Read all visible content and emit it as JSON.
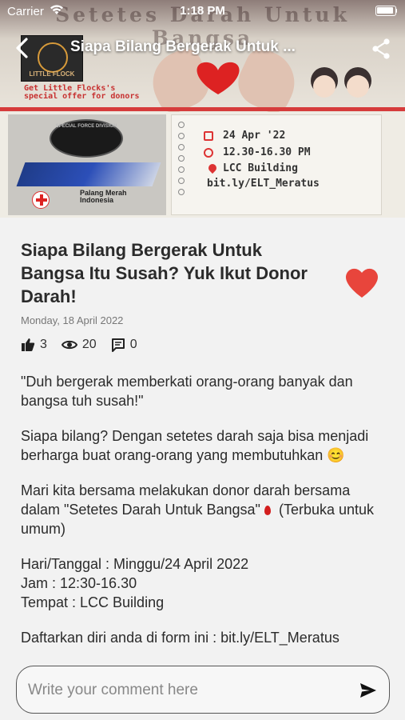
{
  "status_bar": {
    "carrier": "Carrier",
    "time": "1:18 PM"
  },
  "navbar": {
    "title": "Siapa Bilang Bergerak Untuk ..."
  },
  "hero": {
    "banner_text": "Setetes Darah Untuk Bangsa",
    "logo_label": "LITTLE FLOCK",
    "offer_text": "Get Little Flocks's special offer for donors",
    "badge_label": "SPECIAL FORCE DIVISION",
    "pmi_text": "Palang Merah Indonesia",
    "details": [
      "24 Apr '22",
      "12.30-16.30 PM",
      "LCC Building",
      "bit.ly/ELT_Meratus"
    ]
  },
  "post": {
    "title": "Siapa Bilang Bergerak Untuk Bangsa Itu Susah? Yuk Ikut Donor Darah!",
    "date": "Monday, 18 April 2022",
    "likes": "3",
    "views": "20",
    "comments": "0",
    "paragraphs": {
      "p1": "\"Duh bergerak memberkati orang-orang banyak dan bangsa tuh susah!\"",
      "p2": "Siapa bilang? Dengan setetes darah saja bisa menjadi berharga buat orang-orang yang membutuhkan 😊",
      "p3a": "Mari kita bersama melakukan donor darah bersama dalam \"Setetes Darah Untuk Bangsa\"",
      "p3b": "(Terbuka untuk umum)",
      "p4_line1": "Hari/Tanggal : Minggu/24 April 2022",
      "p4_line2": "Jam : 12:30-16.30",
      "p4_line3": "Tempat : LCC Building",
      "p5": "Daftarkan diri anda di form ini : bit.ly/ELT_Meratus"
    }
  },
  "comment": {
    "placeholder": "Write your comment here"
  },
  "colors": {
    "heart": "#e8453c",
    "accent_red": "#d63b3b"
  }
}
